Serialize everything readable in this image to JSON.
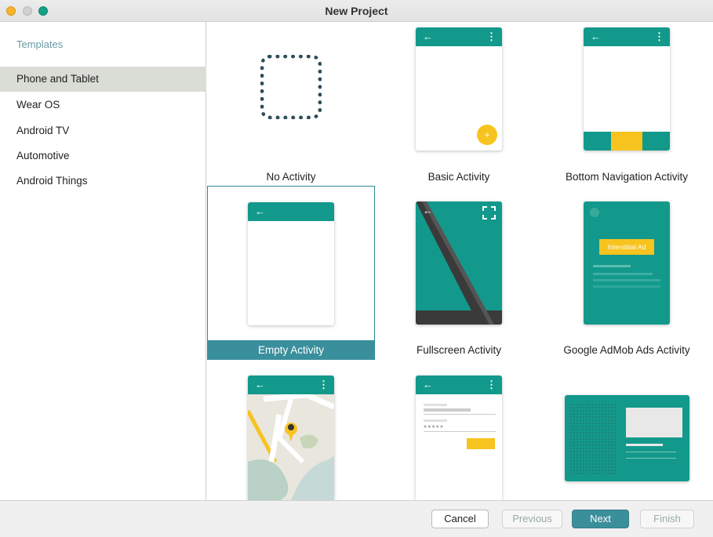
{
  "window": {
    "title": "New Project"
  },
  "sidebar": {
    "header": "Templates",
    "items": [
      {
        "label": "Phone and Tablet",
        "selected": true
      },
      {
        "label": "Wear OS"
      },
      {
        "label": "Android TV"
      },
      {
        "label": "Automotive"
      },
      {
        "label": "Android Things"
      }
    ]
  },
  "templates": [
    {
      "label": "No Activity",
      "icon": "dashed-square-icon"
    },
    {
      "label": "Basic Activity",
      "icon": "basic-activity-preview"
    },
    {
      "label": "Bottom Navigation Activity",
      "icon": "bottom-nav-preview"
    },
    {
      "label": "Empty Activity",
      "icon": "empty-activity-preview",
      "selected": true
    },
    {
      "label": "Fullscreen Activity",
      "icon": "fullscreen-preview"
    },
    {
      "label": "Google AdMob Ads Activity",
      "icon": "admob-preview",
      "ad_text": "Interstitial Ad"
    },
    {
      "label": "",
      "icon": "maps-preview"
    },
    {
      "label": "",
      "icon": "login-preview"
    },
    {
      "label": "",
      "icon": "master-detail-preview"
    }
  ],
  "footer": {
    "cancel": "Cancel",
    "previous": "Previous",
    "next": "Next",
    "finish": "Finish"
  },
  "colors": {
    "accent": "#12998b",
    "selected": "#3a8f9c",
    "fab": "#f7c31f"
  }
}
